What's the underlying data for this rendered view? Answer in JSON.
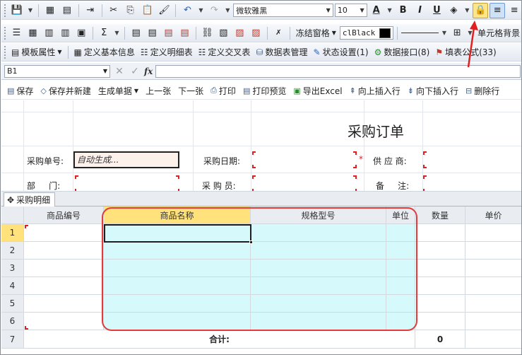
{
  "toolbar1": {
    "font_name": "微软雅黑",
    "font_size": "10"
  },
  "toolbar2": {
    "freeze_label": "冻结窗格",
    "color_value": "clBlack",
    "cell_bg_label": "单元格背景"
  },
  "toolbar3": {
    "items": [
      {
        "label": "模板属性",
        "icon": "template-icon"
      },
      {
        "label": "定义基本信息",
        "icon": "table-icon"
      },
      {
        "label": "定义明细表",
        "icon": "detail-table-icon"
      },
      {
        "label": "定义交叉表",
        "icon": "cross-table-icon"
      },
      {
        "label": "数据表管理",
        "icon": "db-manage-icon"
      },
      {
        "label": "状态设置(1)",
        "icon": "status-icon"
      },
      {
        "label": "数据接口(8)",
        "icon": "interface-icon"
      },
      {
        "label": "填表公式(33)",
        "icon": "formula-icon"
      }
    ]
  },
  "formula_bar": {
    "cell_ref": "B1",
    "fx": "fx"
  },
  "form_toolbar": {
    "items": [
      {
        "label": "保存",
        "icon": "save-icon"
      },
      {
        "label": "保存并新建",
        "icon": "save-new-icon"
      },
      {
        "label": "生成单据",
        "icon": ""
      },
      {
        "label": "上一张",
        "icon": ""
      },
      {
        "label": "下一张",
        "icon": ""
      },
      {
        "label": "打印",
        "icon": "print-icon"
      },
      {
        "label": "打印预览",
        "icon": "print-preview-icon"
      },
      {
        "label": "导出Excel",
        "icon": "excel-icon"
      },
      {
        "label": "向上插入行",
        "icon": "insert-up-icon"
      },
      {
        "label": "向下插入行",
        "icon": "insert-down-icon"
      },
      {
        "label": "删除行",
        "icon": "delete-row-icon"
      }
    ]
  },
  "form": {
    "title": "采购订单",
    "order_no_label": "采购单号:",
    "order_no_value": "自动生成...",
    "order_date_label": "采购日期:",
    "supplier_label": "供 应 商:",
    "dept_label": "部     门:",
    "buyer_label": "采 购 员:",
    "remark_label": "备     注:",
    "required_mark": "*"
  },
  "tab": {
    "label": "采购明细"
  },
  "grid": {
    "columns": [
      "商品编号",
      "商品名称",
      "规格型号",
      "单位",
      "数量",
      "单价"
    ],
    "rows": [
      "1",
      "2",
      "3",
      "4",
      "5",
      "6",
      "7"
    ],
    "total_label": "合计:",
    "total_qty": "0"
  },
  "colors": {
    "highlight_border": "#e43a3a",
    "selected_header": "#ffe27c",
    "detail_fill": "#d6fafc"
  }
}
